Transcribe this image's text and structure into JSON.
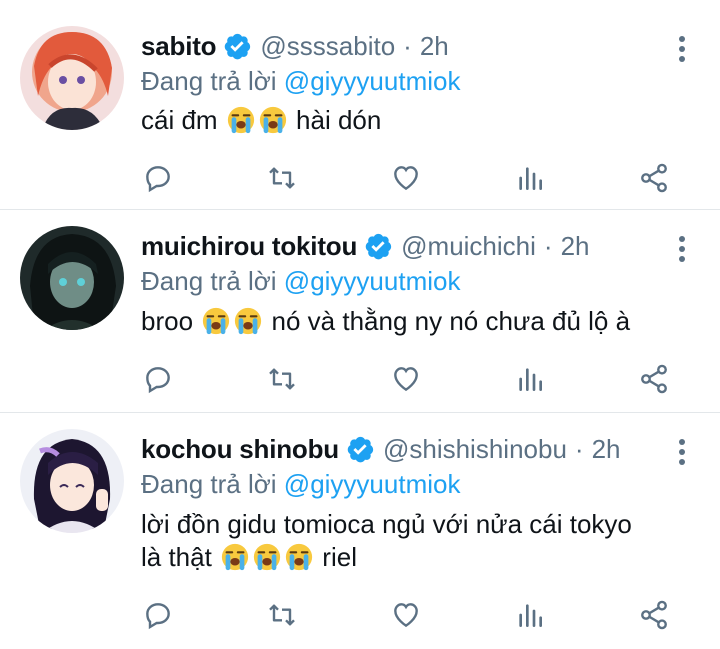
{
  "tweets": [
    {
      "name": "sabito",
      "handle": "@ssssabito",
      "dot": "·",
      "time": "2h",
      "reply_prefix": "Đang trả lời",
      "reply_to": "@giyyyuutmiok",
      "text_lines": [
        {
          "before": "cái đm",
          "emojis": 2,
          "after": "hài dón"
        }
      ]
    },
    {
      "name": "muichirou tokitou",
      "handle": "@muichichi",
      "dot": "·",
      "time": "2h",
      "reply_prefix": "Đang trả lời",
      "reply_to": "@giyyyuutmiok",
      "text_lines": [
        {
          "before": "broo",
          "emojis": 2,
          "after": "nó và thằng ny nó chưa đủ lộ à"
        }
      ]
    },
    {
      "name": "kochou shinobu",
      "handle": "@shishishinobu",
      "dot": "·",
      "time": "2h",
      "reply_prefix": "Đang trả lời",
      "reply_to": "@giyyyuutmiok",
      "text_lines": [
        {
          "before": "lời đồn gidu tomioca ngủ với nửa cái tokyo",
          "emojis": 0,
          "after": ""
        },
        {
          "before": "là thật",
          "emojis": 3,
          "after": "riel"
        }
      ]
    }
  ],
  "icons": {
    "verified": "verified-badge-icon",
    "more": "more-vertical-icon",
    "reply": "reply-icon",
    "retweet": "retweet-icon",
    "like": "heart-icon",
    "analytics": "analytics-icon",
    "share": "share-icon",
    "emoji": "loudly-crying-face-emoji"
  },
  "colors": {
    "text": "#0f1419",
    "secondary": "#5b7083",
    "accent": "#1da1f2",
    "divider": "#e3e7ea"
  }
}
